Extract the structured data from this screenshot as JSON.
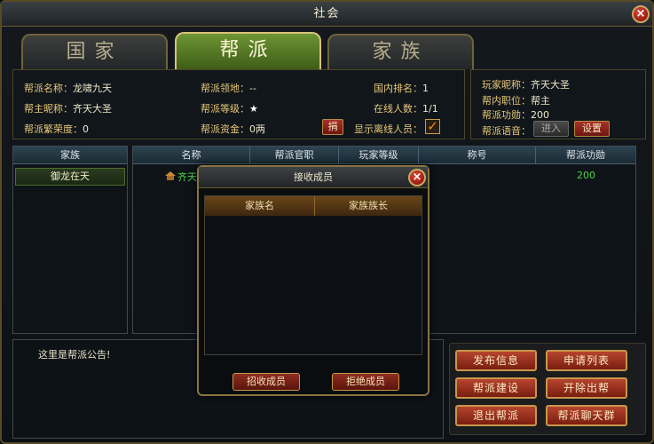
{
  "window": {
    "title": "社会",
    "close": "×"
  },
  "tabs": [
    {
      "label": "国家",
      "active": false
    },
    {
      "label": "帮派",
      "active": true
    },
    {
      "label": "家族",
      "active": false
    }
  ],
  "guild_info": {
    "name_label": "帮派名称：",
    "name": "龙啸九天",
    "leader_label": "帮主昵称：",
    "leader": "齐天大圣",
    "prosperity_label": "帮派繁荣度：",
    "prosperity": "0",
    "territory_label": "帮派领地：",
    "territory": "--",
    "level_label": "帮派等级：",
    "level": "★",
    "funds_label": "帮派资金：",
    "funds": "0两",
    "donate_button": "捐",
    "rank_label": "国内排名：",
    "rank": "1",
    "online_label": "在线人数：",
    "online": "1/1",
    "show_offline_label": "显示离线人员：",
    "show_offline_checked": "✓"
  },
  "player_info": {
    "nickname_label": "玩家昵称：",
    "nickname": "齐天大圣",
    "position_label": "帮内职位：",
    "position": "帮主",
    "merit_label": "帮派功勋：",
    "merit": "200",
    "voice_label": "帮派语音：",
    "enter_button": "进入",
    "settings_button": "设置"
  },
  "family_list": {
    "header": "家族",
    "selected": "御龙在天"
  },
  "member_table": {
    "columns": [
      "名称",
      "帮派官职",
      "玩家等级",
      "称号",
      "帮派功勋"
    ],
    "rows": [
      {
        "name": "齐天",
        "merit": "200"
      }
    ]
  },
  "notice": {
    "text": "这里是帮派公告!"
  },
  "actions": {
    "publish": "发布信息",
    "apply_list": "申请列表",
    "build": "帮派建设",
    "expel": "开除出帮",
    "leave": "退出帮派",
    "chat": "帮派聊天群"
  },
  "modal": {
    "title": "接收成员",
    "close": "×",
    "columns": [
      "家族名",
      "家族族长"
    ],
    "accept": "招收成员",
    "reject": "拒绝成员"
  }
}
